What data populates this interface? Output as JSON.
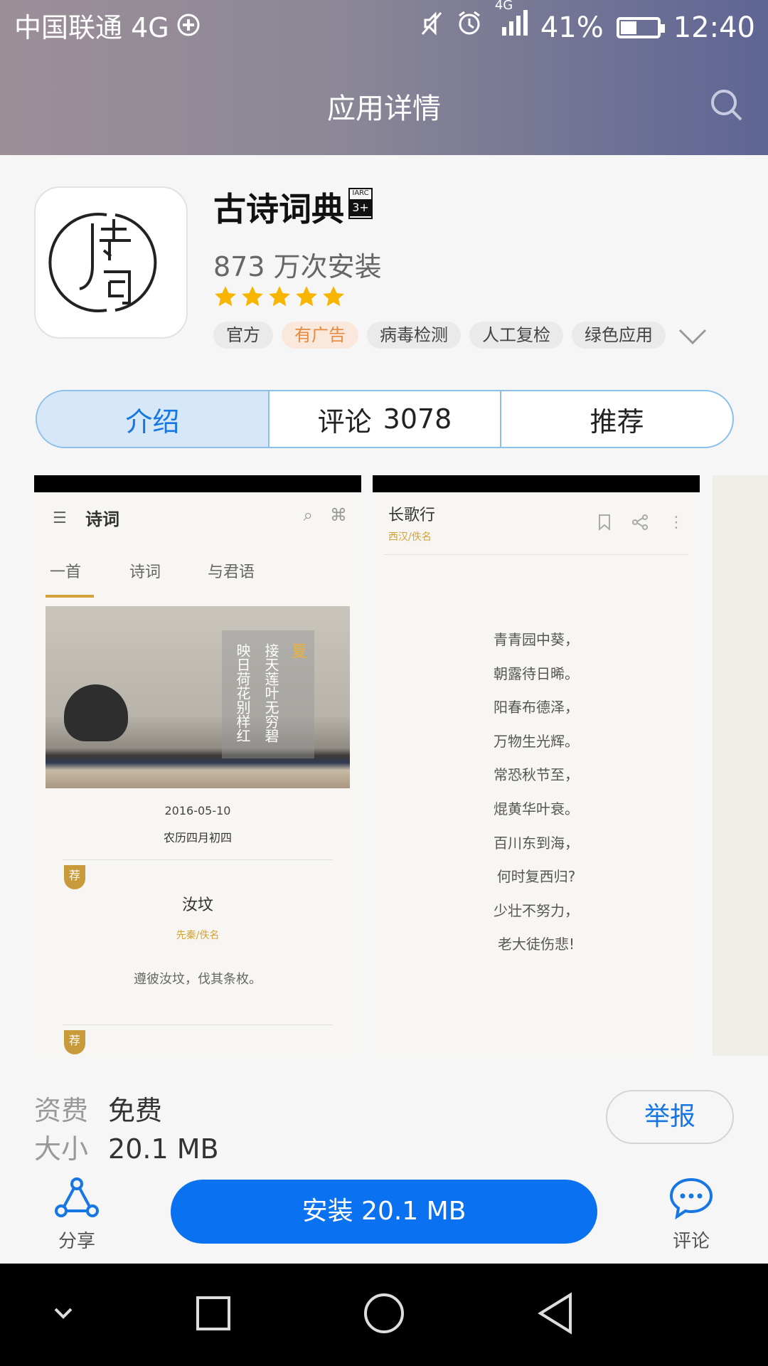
{
  "status_bar": {
    "carrier": "中国联通 4G",
    "network": "4G",
    "battery": "41%",
    "battery_level": 0.41,
    "time": "12:40"
  },
  "header": {
    "title": "应用详情",
    "search_icon": "search-icon"
  },
  "app": {
    "name": "古诗词典",
    "age_rating_top": "IARC",
    "age_rating": "3+",
    "installs": "873 万次安装",
    "rating_stars": 5,
    "tags": [
      "官方",
      "有广告",
      "病毒检测",
      "人工复检",
      "绿色应用"
    ],
    "icon_text": "诗词"
  },
  "tabs": [
    {
      "label": "介绍",
      "count": ""
    },
    {
      "label": "评论",
      "count": "3078"
    },
    {
      "label": "推荐",
      "count": ""
    }
  ],
  "screenshot1": {
    "appbar_title": "诗词",
    "tabs": [
      "一首",
      "诗词",
      "与君语"
    ],
    "poem_lines": [
      "接天莲叶无穷碧",
      "映日荷花别样红"
    ],
    "season": "夏",
    "date": "2016-05-10",
    "lunar": "农历四月初四",
    "badge": "荐",
    "poem_title": "汝坟",
    "poem_author": "先秦/佚名",
    "poem_line": "遵彼汝坟，伐其条枚。"
  },
  "screenshot2": {
    "title": "长歌行",
    "author": "西汉/佚名",
    "lines": [
      "青青园中葵，",
      "朝露待日晞。",
      "阳春布德泽，",
      "万物生光辉。",
      "常恐秋节至，",
      "焜黄华叶衰。",
      "百川东到海，",
      "何时复西归?",
      "少壮不努力，",
      "老大徒伤悲!"
    ]
  },
  "info": {
    "fee_label": "资费",
    "fee_value": "免费",
    "size_label": "大小",
    "size_value": "20.1 MB"
  },
  "report_label": "举报",
  "action_bar": {
    "share_label": "分享",
    "install_label": "安装 20.1 MB",
    "comment_label": "评论"
  },
  "colors": {
    "accent": "#0a72f0",
    "star": "#f7b500",
    "tab_active_bg": "#d6e8f7",
    "ad_tag": "#e58a3e"
  }
}
